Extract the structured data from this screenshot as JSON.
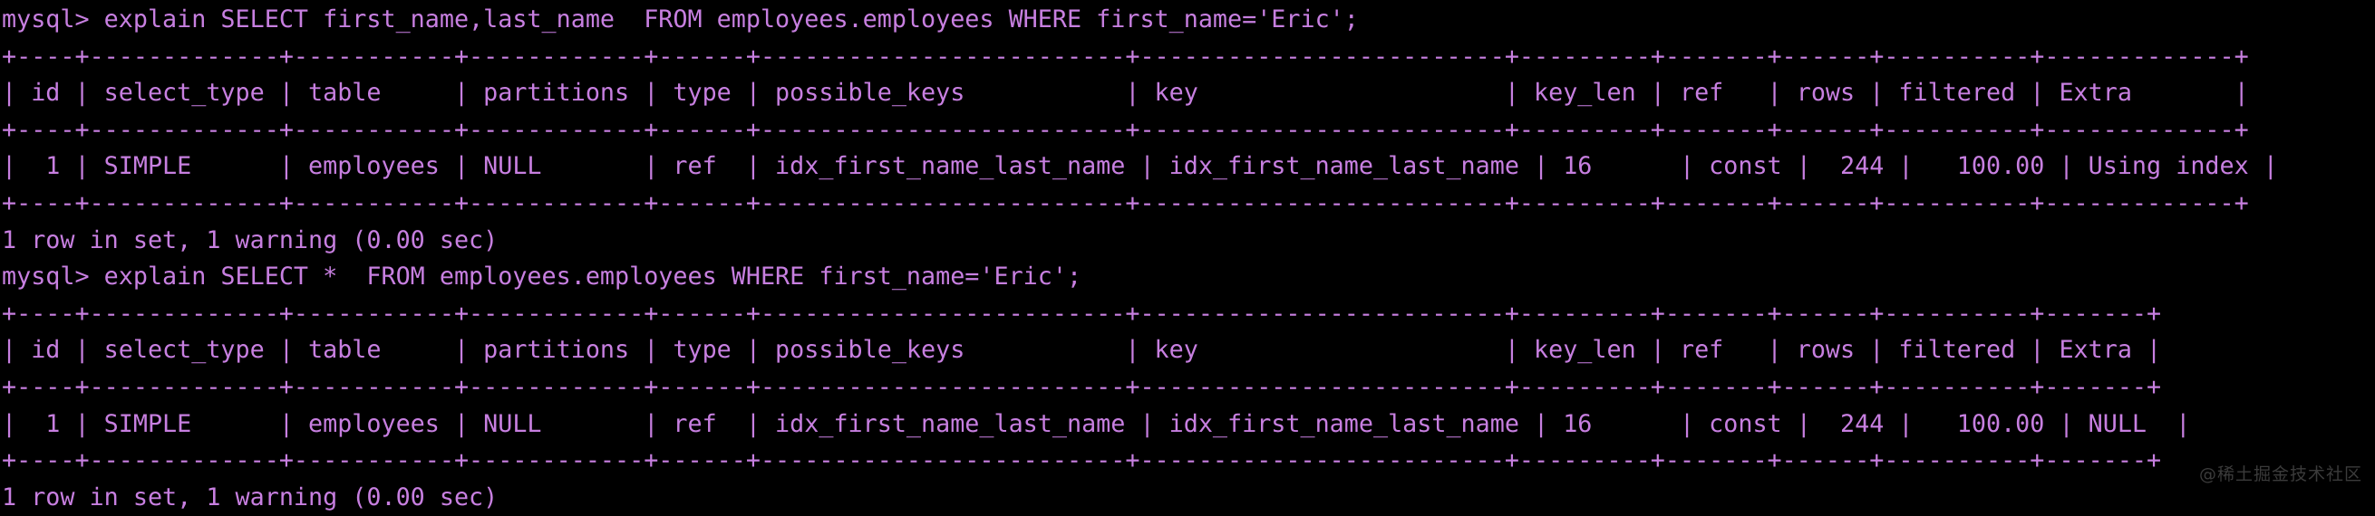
{
  "terminal": {
    "background_color": "#000000",
    "foreground_color": "#c77fe0",
    "watermark": "@稀土掘金技术社区"
  },
  "blocks": [
    {
      "prompt": "mysql> explain SELECT first_name,last_name  FROM employees.employees WHERE first_name='Eric';",
      "rule_top": "+----+-------------+-----------+------------+------+-------------------------+-------------------------+---------+-------+------+----------+-------------+",
      "header": "| id | select_type | table     | partitions | type | possible_keys           | key                     | key_len | ref   | rows | filtered | Extra       |",
      "rule_mid": "+----+-------------+-----------+------------+------+-------------------------+-------------------------+---------+-------+------+----------+-------------+",
      "row": "|  1 | SIMPLE      | employees | NULL       | ref  | idx_first_name_last_name | idx_first_name_last_name | 16      | const |  244 |   100.00 | Using index |",
      "rule_bottom": "+----+-------------+-----------+------------+------+-------------------------+-------------------------+---------+-------+------+----------+-------------+",
      "status": "1 row in set, 1 warning (0.00 sec)"
    },
    {
      "prompt": "mysql> explain SELECT *  FROM employees.employees WHERE first_name='Eric';",
      "rule_top": "+----+-------------+-----------+------------+------+-------------------------+-------------------------+---------+-------+------+----------+-------+",
      "header": "| id | select_type | table     | partitions | type | possible_keys           | key                     | key_len | ref   | rows | filtered | Extra |",
      "rule_mid": "+----+-------------+-----------+------------+------+-------------------------+-------------------------+---------+-------+------+----------+-------+",
      "row": "|  1 | SIMPLE      | employees | NULL       | ref  | idx_first_name_last_name | idx_first_name_last_name | 16      | const |  244 |   100.00 | NULL  |",
      "rule_bottom": "+----+-------------+-----------+------------+------+-------------------------+-------------------------+---------+-------+------+----------+-------+",
      "status": "1 row in set, 1 warning (0.00 sec)"
    }
  ],
  "explain_tables": [
    {
      "columns": [
        "id",
        "select_type",
        "table",
        "partitions",
        "type",
        "possible_keys",
        "key",
        "key_len",
        "ref",
        "rows",
        "filtered",
        "Extra"
      ],
      "rows": [
        [
          "1",
          "SIMPLE",
          "employees",
          "NULL",
          "ref",
          "idx_first_name_last_name",
          "idx_first_name_last_name",
          "16",
          "const",
          "244",
          "100.00",
          "Using index"
        ]
      ]
    },
    {
      "columns": [
        "id",
        "select_type",
        "table",
        "partitions",
        "type",
        "possible_keys",
        "key",
        "key_len",
        "ref",
        "rows",
        "filtered",
        "Extra"
      ],
      "rows": [
        [
          "1",
          "SIMPLE",
          "employees",
          "NULL",
          "ref",
          "idx_first_name_last_name",
          "idx_first_name_last_name",
          "16",
          "const",
          "244",
          "100.00",
          "NULL"
        ]
      ]
    }
  ]
}
